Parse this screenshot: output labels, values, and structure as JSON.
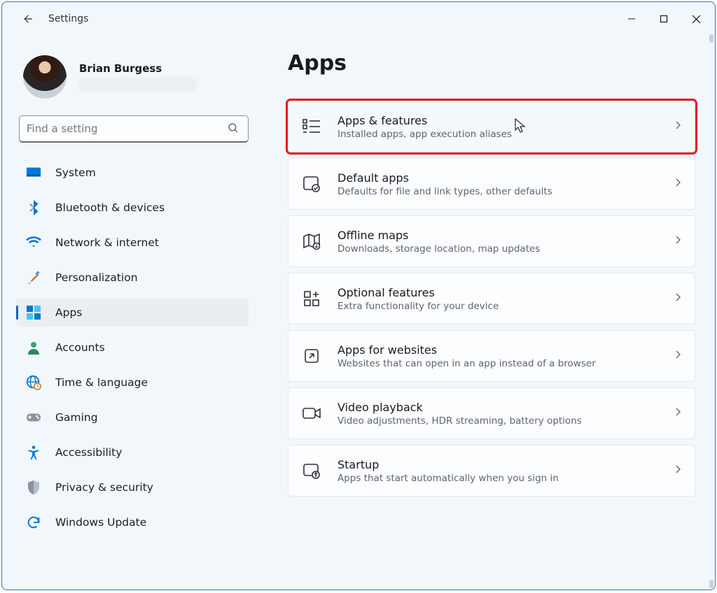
{
  "window": {
    "app_title": "Settings"
  },
  "profile": {
    "name": "Brian Burgess"
  },
  "search": {
    "placeholder": "Find a setting"
  },
  "sidebar": {
    "items": [
      {
        "icon": "monitor",
        "label": "System"
      },
      {
        "icon": "bluetooth",
        "label": "Bluetooth & devices"
      },
      {
        "icon": "wifi",
        "label": "Network & internet"
      },
      {
        "icon": "brush",
        "label": "Personalization"
      },
      {
        "icon": "apps",
        "label": "Apps",
        "active": true
      },
      {
        "icon": "person",
        "label": "Accounts"
      },
      {
        "icon": "globe-clock",
        "label": "Time & language"
      },
      {
        "icon": "gamepad",
        "label": "Gaming"
      },
      {
        "icon": "accessibility",
        "label": "Accessibility"
      },
      {
        "icon": "shield",
        "label": "Privacy & security"
      },
      {
        "icon": "sync",
        "label": "Windows Update"
      }
    ]
  },
  "main": {
    "page_title": "Apps",
    "cards": [
      {
        "icon": "list",
        "title": "Apps & features",
        "sub": "Installed apps, app execution aliases",
        "highlight": true,
        "cursor": true
      },
      {
        "icon": "default",
        "title": "Default apps",
        "sub": "Defaults for file and link types, other defaults"
      },
      {
        "icon": "map",
        "title": "Offline maps",
        "sub": "Downloads, storage location, map updates"
      },
      {
        "icon": "plus-grid",
        "title": "Optional features",
        "sub": "Extra functionality for your device"
      },
      {
        "icon": "open-ext",
        "title": "Apps for websites",
        "sub": "Websites that can open in an app instead of a browser"
      },
      {
        "icon": "video",
        "title": "Video playback",
        "sub": "Video adjustments, HDR streaming, battery options"
      },
      {
        "icon": "startup",
        "title": "Startup",
        "sub": "Apps that start automatically when you sign in"
      }
    ]
  }
}
